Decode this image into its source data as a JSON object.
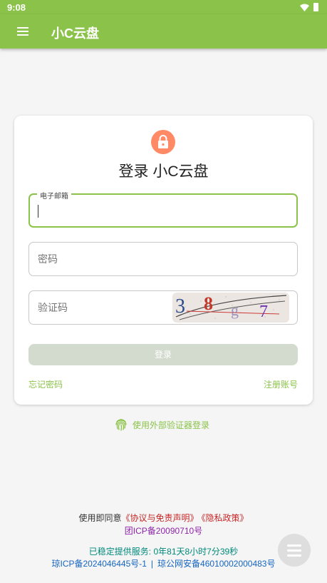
{
  "status_bar": {
    "time": "9:08"
  },
  "app_bar": {
    "title": "小C云盘"
  },
  "login": {
    "title": "登录 小C云盘",
    "email": {
      "label": "电子邮箱",
      "value": ""
    },
    "password": {
      "placeholder": "密码"
    },
    "captcha": {
      "placeholder": "验证码",
      "image_text": "38g7"
    },
    "submit_label": "登录",
    "forgot_label": "忘记密码",
    "register_label": "注册账号"
  },
  "external_login": {
    "label": "使用外部验证器登录"
  },
  "footer": {
    "agree_prefix": "使用即同意",
    "agreement_link": "《协议与免责声明》",
    "privacy_link": "《隐私政策》",
    "group_icp": "团ICP备20090710号",
    "uptime": "已稳定提供服务: 0年81天8小时7分39秒",
    "qiong_icp": "琼ICP备2024046445号-1",
    "separator": "|",
    "police_record": "琼公网安备46010002000483号"
  },
  "colors": {
    "primary": "#8bc34a",
    "accent_lock": "#ff8a65",
    "link_red": "#c62828",
    "icp_purple": "#8e24aa",
    "uptime_teal": "#00897b",
    "record_blue": "#1565c0"
  }
}
